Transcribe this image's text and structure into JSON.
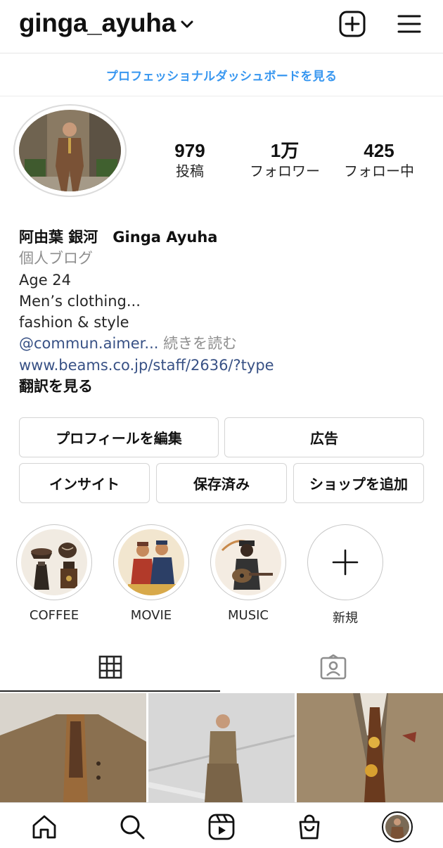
{
  "header": {
    "username": "ginga_ayuha",
    "create_icon": "plus-square-icon",
    "menu_icon": "hamburger-menu-icon"
  },
  "pro_dashboard": {
    "label": "プロフェッショナルダッシュボードを見る"
  },
  "stats": [
    {
      "value": "979",
      "label": "投稿"
    },
    {
      "value": "1万",
      "label": "フォロワー"
    },
    {
      "value": "425",
      "label": "フォロー中"
    }
  ],
  "bio": {
    "name": "阿由葉 銀河　Ginga Ayuha",
    "category": "個人ブログ",
    "line1": "Age 24",
    "line2": "Men’s clothing...",
    "line3": "fashion & style",
    "mention": "@commun.aimer...",
    "more": "続きを読む",
    "link": "www.beams.co.jp/staff/2636/?type",
    "translate": "翻訳を見る"
  },
  "buttons": {
    "edit_profile": "プロフィールを編集",
    "ads": "広告",
    "insights": "インサイト",
    "saved": "保存済み",
    "add_shop": "ショップを追加"
  },
  "highlights": [
    {
      "label": "COFFEE"
    },
    {
      "label": "MOVIE"
    },
    {
      "label": "MUSIC"
    },
    {
      "label": "新規"
    }
  ],
  "tabs": {
    "grid_icon": "grid-icon",
    "tagged_icon": "tagged-person-icon"
  },
  "nav": [
    "home-icon",
    "search-icon",
    "reels-icon",
    "shop-icon",
    "profile-avatar"
  ],
  "colors": {
    "link_blue": "#3897f0",
    "bio_link": "#385185",
    "muted": "#8e8e8e",
    "border": "#dbdbdb"
  }
}
